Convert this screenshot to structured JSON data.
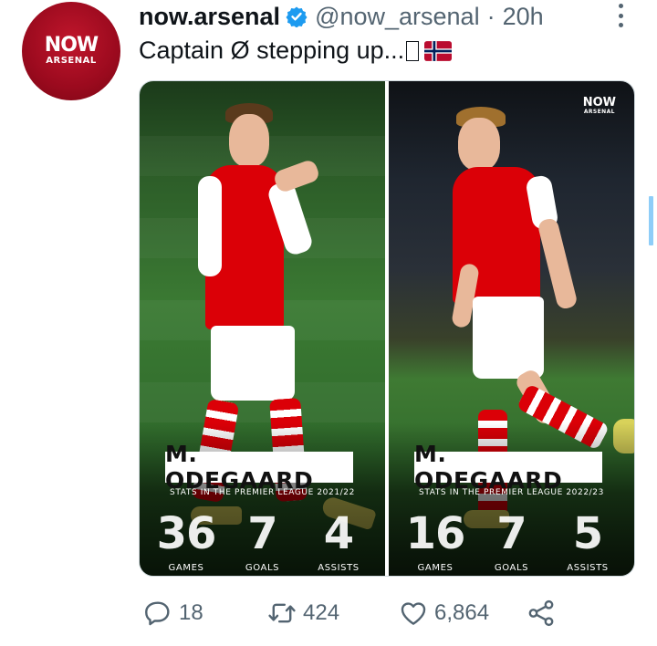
{
  "profile": {
    "display_name": "now.arsenal",
    "handle": "@now_arsenal",
    "separator": "·",
    "time_ago": "20h",
    "avatar_line1": "NOW",
    "avatar_line2": "ARSENAL"
  },
  "tweet": {
    "text": "Captain Ø stepping up...",
    "flag": "norway-flag"
  },
  "media": {
    "logo_line1": "NOW",
    "logo_line2": "ARSENAL",
    "panels": [
      {
        "player_name": "M. ODEGAARD",
        "subtitle": "STATS IN THE PREMIER LEAGUE 2021/22",
        "stats": [
          {
            "value": "36",
            "label": "GAMES"
          },
          {
            "value": "7",
            "label": "GOALS"
          },
          {
            "value": "4",
            "label": "ASSISTS"
          }
        ]
      },
      {
        "player_name": "M. ODEGAARD",
        "subtitle": "STATS IN THE PREMIER LEAGUE 2022/23",
        "stats": [
          {
            "value": "16",
            "label": "GAMES"
          },
          {
            "value": "7",
            "label": "GOALS"
          },
          {
            "value": "5",
            "label": "ASSISTS"
          }
        ]
      }
    ]
  },
  "actions": {
    "reply_count": "18",
    "retweet_count": "424",
    "like_count": "6,864"
  },
  "colors": {
    "verified": "#1d9bf0",
    "secondary_text": "#536471",
    "arsenal_red": "#db0007"
  }
}
